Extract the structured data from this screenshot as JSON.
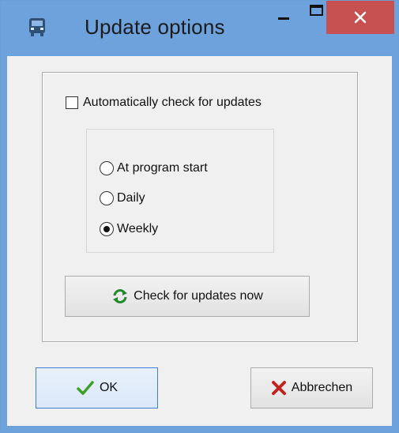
{
  "window": {
    "title": "Update options"
  },
  "auto_check": {
    "label": "Automatically check for updates",
    "checked": false
  },
  "frequency": {
    "options": [
      {
        "label": "At program start",
        "selected": false
      },
      {
        "label": "Daily",
        "selected": false
      },
      {
        "label": "Weekly",
        "selected": true
      }
    ]
  },
  "buttons": {
    "check_now": "Check for updates now",
    "ok": "OK",
    "cancel": "Abbrechen"
  },
  "icons": {
    "app": "bus-icon",
    "minimize": "minimize-icon",
    "maximize": "maximize-icon",
    "close": "close-icon",
    "refresh": "refresh-icon",
    "ok": "checkmark-icon",
    "cancel": "red-x-icon"
  },
  "colors": {
    "titlebar": "#6ea2dc",
    "close_button": "#c75050",
    "client_bg": "#f0f0f0",
    "ok_border": "#3c7fd8"
  }
}
